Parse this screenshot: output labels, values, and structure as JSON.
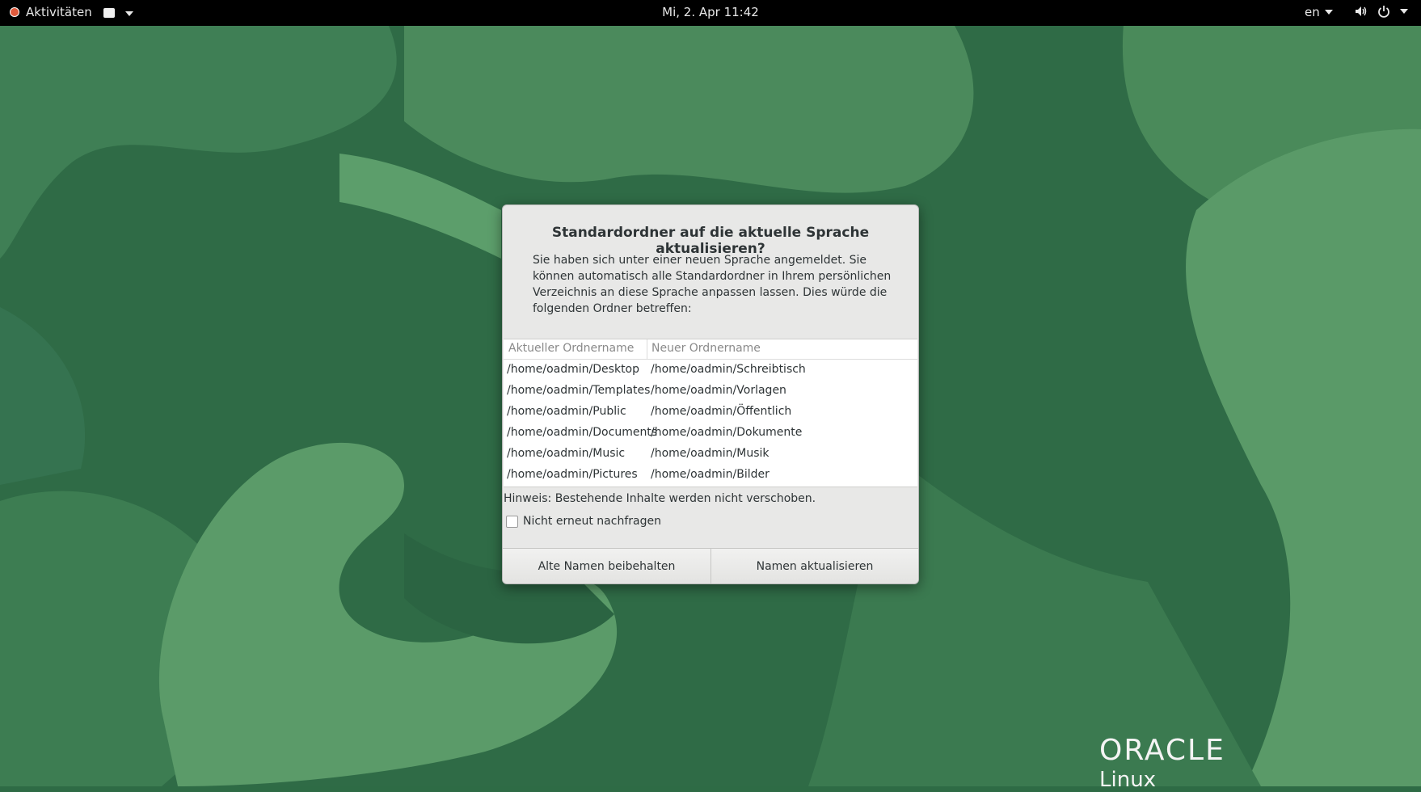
{
  "topbar": {
    "activities_label": "Aktivitäten",
    "clock": "Mi,  2. Apr  11:42",
    "language": "en",
    "icons": [
      "volume-icon",
      "power-icon"
    ]
  },
  "dialog": {
    "title": "Standardordner auf die aktuelle Sprache aktualisieren?",
    "message": "Sie haben sich unter einer neuen Sprache angemeldet. Sie können automatisch alle Standardordner in Ihrem persönlichen Verzeichnis an diese Sprache anpassen lassen. Dies würde die folgenden Ordner betreffen:",
    "columns": [
      "Aktueller Ordnername",
      "Neuer Ordnername"
    ],
    "rows": [
      [
        "/home/oadmin/Desktop",
        "/home/oadmin/Schreibtisch"
      ],
      [
        "/home/oadmin/Templates",
        "/home/oadmin/Vorlagen"
      ],
      [
        "/home/oadmin/Public",
        "/home/oadmin/Öffentlich"
      ],
      [
        "/home/oadmin/Documents",
        "/home/oadmin/Dokumente"
      ],
      [
        "/home/oadmin/Music",
        "/home/oadmin/Musik"
      ],
      [
        "/home/oadmin/Pictures",
        "/home/oadmin/Bilder"
      ]
    ],
    "note": "Hinweis: Bestehende Inhalte werden nicht verschoben.",
    "checkbox_label": "Nicht erneut nachfragen",
    "checkbox_checked": false,
    "button_keep": "Alte Namen beibehalten",
    "button_update": "Namen aktualisieren"
  },
  "logo": {
    "brand": "ORACLE",
    "product": "Linux"
  },
  "colors": {
    "wallpaper_base": "#2e6b45",
    "wallpaper_light": "#4e8f5e",
    "topbar": "#000000",
    "dialog_bg": "#e8e8e7"
  }
}
